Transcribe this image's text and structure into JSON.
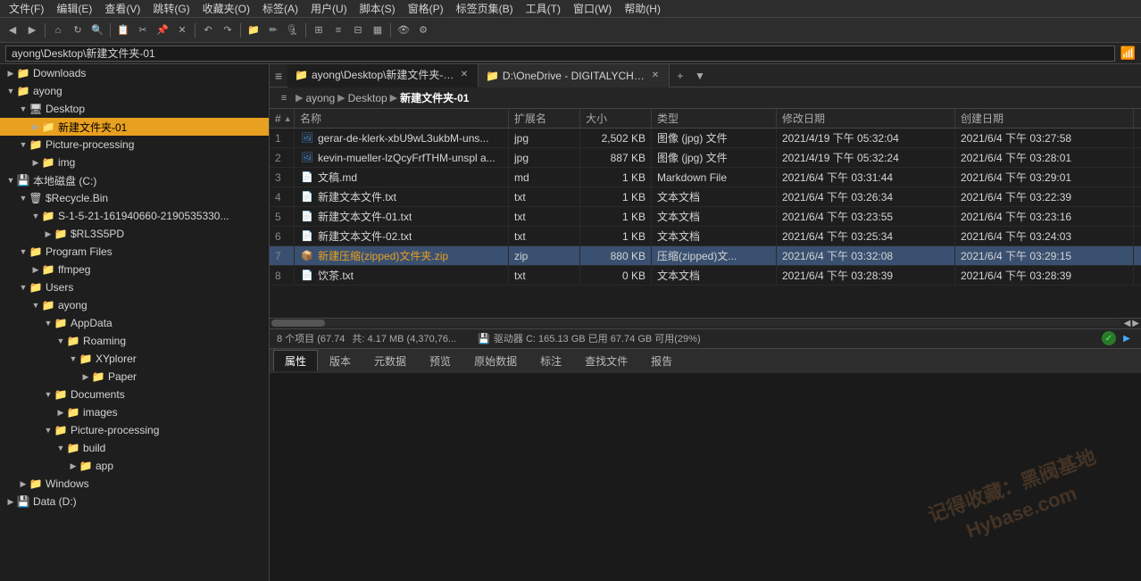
{
  "menubar": {
    "items": [
      "文件(F)",
      "编辑(E)",
      "查看(V)",
      "跳转(G)",
      "收藏夹(O)",
      "标签(A)",
      "用户(U)",
      "脚本(S)",
      "窗格(P)",
      "标签页集(B)",
      "工具(T)",
      "窗口(W)",
      "帮助(H)"
    ]
  },
  "address": {
    "path": "ayong\\Desktop\\新建文件夹-01"
  },
  "tabs": [
    {
      "label": "ayong\\Desktop\\新建文件夹-01",
      "active": true,
      "icon": "folder"
    },
    {
      "label": "D:\\OneDrive - DIGITALYCHEE\\内...\\通稿图片",
      "active": false,
      "icon": "folder"
    }
  ],
  "breadcrumb": {
    "parts": [
      "ayong",
      "Desktop",
      "新建文件夹-01"
    ]
  },
  "columns": {
    "num": "#",
    "name": "名称",
    "ext": "扩展名",
    "size": "大小",
    "type": "类型",
    "modified": "修改日期",
    "created": "创建日期"
  },
  "files": [
    {
      "num": "1",
      "name": "gerar-de-klerk-xbU9wL3ukbM-uns...",
      "ext": "jpg",
      "size": "2,502 KB",
      "type": "图像 (jpg) 文件",
      "modified": "2021/4/19 下午 05:32:04",
      "created": "2021/6/4 下午 03:27:58",
      "icon": "img",
      "selected": false
    },
    {
      "num": "2",
      "name": "kevin-mueller-lzQcyFrfTHM-unspl a...",
      "ext": "jpg",
      "size": "887 KB",
      "type": "图像 (jpg) 文件",
      "modified": "2021/4/19 下午 05:32:24",
      "created": "2021/6/4 下午 03:28:01",
      "icon": "img",
      "selected": false
    },
    {
      "num": "3",
      "name": "文稿.md",
      "ext": "md",
      "size": "1 KB",
      "type": "Markdown File",
      "modified": "2021/6/4 下午 03:31:44",
      "created": "2021/6/4 下午 03:29:01",
      "icon": "doc",
      "selected": false
    },
    {
      "num": "4",
      "name": "新建文本文件.txt",
      "ext": "txt",
      "size": "1 KB",
      "type": "文本文档",
      "modified": "2021/6/4 下午 03:26:34",
      "created": "2021/6/4 下午 03:22:39",
      "icon": "txt",
      "selected": false
    },
    {
      "num": "5",
      "name": "新建文本文件-01.txt",
      "ext": "txt",
      "size": "1 KB",
      "type": "文本文档",
      "modified": "2021/6/4 下午 03:23:55",
      "created": "2021/6/4 下午 03:23:16",
      "icon": "txt",
      "selected": false
    },
    {
      "num": "6",
      "name": "新建文本文件-02.txt",
      "ext": "txt",
      "size": "1 KB",
      "type": "文本文档",
      "modified": "2021/6/4 下午 03:25:34",
      "created": "2021/6/4 下午 03:24:03",
      "icon": "txt",
      "selected": false
    },
    {
      "num": "7",
      "name": "新建压缩(zipped)文件夹.zip",
      "ext": "zip",
      "size": "880 KB",
      "type": "压缩(zipped)文...",
      "modified": "2021/6/4 下午 03:32:08",
      "created": "2021/6/4 下午 03:29:15",
      "icon": "zip",
      "selected": true,
      "highlighted": true
    },
    {
      "num": "8",
      "name": "饮茶.txt",
      "ext": "txt",
      "size": "0 KB",
      "type": "文本文档",
      "modified": "2021/6/4 下午 03:28:39",
      "created": "2021/6/4 下午 03:28:39",
      "icon": "txt",
      "selected": false
    }
  ],
  "statusbar": {
    "items": "8 个项目 (67.74",
    "total": "共: 4.17 MB (4,370,76...",
    "drive": "驱动器 C:  165.13 GB 已用  67.74 GB 可用(29%)",
    "drive_icon": "💾"
  },
  "bottom_tabs": [
    "属性",
    "版本",
    "元数据",
    "预览",
    "原始数据",
    "标注",
    "查找文件",
    "报告"
  ],
  "active_bottom_tab": "属性",
  "tree": [
    {
      "label": "Downloads",
      "level": 0,
      "icon": "📁",
      "expanded": false,
      "selected": false
    },
    {
      "label": "ayong",
      "level": 0,
      "icon": "📁",
      "expanded": true,
      "selected": false
    },
    {
      "label": "Desktop",
      "level": 1,
      "icon": "🖥",
      "expanded": true,
      "selected": false
    },
    {
      "label": "新建文件夹-01",
      "level": 2,
      "icon": "📁",
      "expanded": false,
      "selected": true,
      "highlighted": true
    },
    {
      "label": "Picture-processing",
      "level": 1,
      "icon": "📁",
      "expanded": true,
      "selected": false
    },
    {
      "label": "img",
      "level": 2,
      "icon": "📁",
      "expanded": false,
      "selected": false
    },
    {
      "label": "本地磁盘 (C:)",
      "level": 0,
      "icon": "💾",
      "expanded": true,
      "selected": false
    },
    {
      "label": "$Recycle.Bin",
      "level": 1,
      "icon": "🗑",
      "expanded": true,
      "selected": false
    },
    {
      "label": "S-1-5-21-161940660-2190535330...",
      "level": 2,
      "icon": "📁",
      "expanded": true,
      "selected": false
    },
    {
      "label": "$RL3S5PD",
      "level": 3,
      "icon": "📁",
      "expanded": false,
      "selected": false
    },
    {
      "label": "Program Files",
      "level": 1,
      "icon": "📁",
      "expanded": true,
      "selected": false
    },
    {
      "label": "ffmpeg",
      "level": 2,
      "icon": "📁",
      "expanded": false,
      "selected": false
    },
    {
      "label": "Users",
      "level": 1,
      "icon": "📁",
      "expanded": true,
      "selected": false
    },
    {
      "label": "ayong",
      "level": 2,
      "icon": "📁",
      "expanded": true,
      "selected": false
    },
    {
      "label": "AppData",
      "level": 3,
      "icon": "📁",
      "expanded": true,
      "selected": false
    },
    {
      "label": "Roaming",
      "level": 4,
      "icon": "📁",
      "expanded": true,
      "selected": false
    },
    {
      "label": "XYplorer",
      "level": 5,
      "icon": "📁",
      "expanded": true,
      "selected": false
    },
    {
      "label": "Paper",
      "level": 6,
      "icon": "📁",
      "expanded": false,
      "selected": false
    },
    {
      "label": "Documents",
      "level": 3,
      "icon": "📁",
      "expanded": true,
      "selected": false
    },
    {
      "label": "images",
      "level": 4,
      "icon": "📁",
      "expanded": false,
      "selected": false
    },
    {
      "label": "Picture-processing",
      "level": 3,
      "icon": "📁",
      "expanded": true,
      "selected": false
    },
    {
      "label": "build",
      "level": 4,
      "icon": "📁",
      "expanded": true,
      "selected": false
    },
    {
      "label": "app",
      "level": 5,
      "icon": "📁",
      "expanded": false,
      "selected": false
    },
    {
      "label": "Windows",
      "level": 1,
      "icon": "📁",
      "expanded": false,
      "selected": false
    },
    {
      "label": "Data (D:)",
      "level": 0,
      "icon": "💾",
      "expanded": false,
      "selected": false
    }
  ],
  "watermark": {
    "line1": "记得收藏：黑阀基地",
    "line2": "Hybase.com"
  }
}
